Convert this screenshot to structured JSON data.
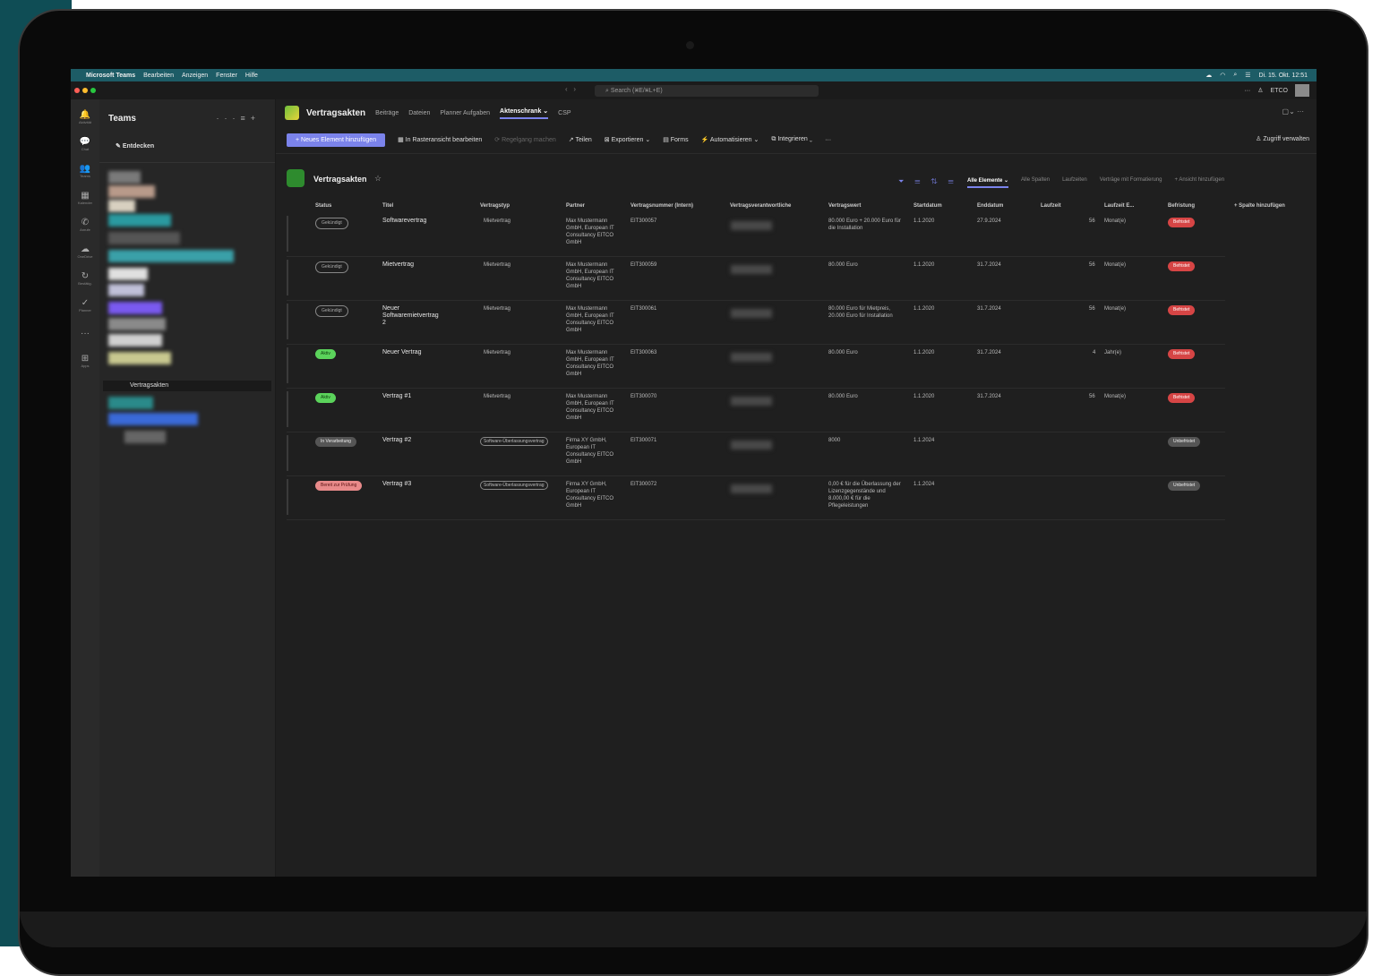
{
  "menubar": {
    "app": "Microsoft Teams",
    "items": [
      "Bearbeiten",
      "Anzeigen",
      "Fenster",
      "Hilfe"
    ],
    "clock": "Di. 15. Okt. 12:51"
  },
  "titlebar": {
    "search_placeholder": "Search (⌘E/⌘L+E)",
    "user": "ETCO"
  },
  "rail": {
    "items": [
      {
        "icon": "bell-icon",
        "glyph": "🔔",
        "label": "Aktivität"
      },
      {
        "icon": "chat-icon",
        "glyph": "💬",
        "label": "Chat"
      },
      {
        "icon": "teams-icon",
        "glyph": "👥",
        "label": "Teams"
      },
      {
        "icon": "calendar-icon",
        "glyph": "▦",
        "label": "Kalender"
      },
      {
        "icon": "phone-icon",
        "glyph": "✆",
        "label": "Anrufe"
      },
      {
        "icon": "cloud-icon",
        "glyph": "☁",
        "label": "OneDrive"
      },
      {
        "icon": "loop-icon",
        "glyph": "↻",
        "label": "Bestätig."
      },
      {
        "icon": "planner-icon",
        "glyph": "✓",
        "label": "Planner"
      },
      {
        "icon": "more-icon",
        "glyph": "···",
        "label": ""
      },
      {
        "icon": "apps-icon",
        "glyph": "⊞",
        "label": "Apps"
      }
    ]
  },
  "teams_pane": {
    "title": "Teams",
    "discover": "Entdecken",
    "selected_channel": "Vertragsakten"
  },
  "tabbar": {
    "title": "Vertragsakten",
    "tabs": [
      "Beiträge",
      "Dateien",
      "Planner Aufgaben",
      "Aktenschrank ⌄",
      "CSP"
    ]
  },
  "cmdbar": {
    "new_item": "+ Neues Element hinzufügen",
    "grid_edit": "In Rasteransicht bearbeiten",
    "rule": "Regelgang machen",
    "share": "Teilen",
    "export": "Exportieren ⌄",
    "forms": "Forms",
    "automate": "Automatisieren ⌄",
    "integrate": "Integrieren ⌄",
    "more": "···",
    "manage_access": "Zugriff verwalten"
  },
  "list": {
    "title": "Vertragsakten",
    "views": [
      "Alle Elemente ⌄",
      "Alle Spalten",
      "Laufzeiten",
      "Verträge mit Formatierung",
      "+ Ansicht hinzufügen"
    ],
    "columns": [
      "Status",
      "Titel",
      "Vertragstyp",
      "Partner",
      "Vertragsnummer (Intern)",
      "Vertragsverantwortliche",
      "Vertragswert",
      "Startdatum",
      "Enddatum",
      "Laufzeit",
      "Laufzeit E...",
      "Befristung",
      "+ Spalte hinzufügen"
    ],
    "rows": [
      {
        "status": "Gekündigt",
        "status_style": "outline",
        "title": "Softwarevertrag",
        "type": "Mietvertrag",
        "partner": "Max Mustermann GmbH, European IT Consultancy EITCO GmbH",
        "number": "EIT300057",
        "value": "80.000 Euro + 20.000 Euro für die Installation",
        "start": "1.1.2020",
        "end": "27.9.2024",
        "duration": "56",
        "unit": "Monat(e)",
        "limit": "Befristet",
        "limit_style": "red"
      },
      {
        "status": "Gekündigt",
        "status_style": "outline",
        "title": "Mietvertrag",
        "type": "Mietvertrag",
        "partner": "Max Mustermann GmbH, European IT Consultancy EITCO GmbH",
        "number": "EIT300059",
        "value": "80.000 Euro",
        "start": "1.1.2020",
        "end": "31.7.2024",
        "duration": "56",
        "unit": "Monat(e)",
        "limit": "Befristet",
        "limit_style": "red"
      },
      {
        "status": "Gekündigt",
        "status_style": "outline",
        "title": "Neuer Softwaremietvertrag 2",
        "type": "Mietvertrag",
        "partner": "Max Mustermann GmbH, European IT Consultancy EITCO GmbH",
        "number": "EIT300061",
        "value": "80.000 Euro für Mietpreis, 20.000 Euro für Installation",
        "start": "1.1.2020",
        "end": "31.7.2024",
        "duration": "56",
        "unit": "Monat(e)",
        "limit": "Befristet",
        "limit_style": "red"
      },
      {
        "status": "Aktiv",
        "status_style": "green",
        "title": "Neuer Vertrag",
        "type": "Mietvertrag",
        "partner": "Max Mustermann GmbH, European IT Consultancy EITCO GmbH",
        "number": "EIT300063",
        "value": "80.000 Euro",
        "start": "1.1.2020",
        "end": "31.7.2024",
        "duration": "4",
        "unit": "Jahr(e)",
        "limit": "Befristet",
        "limit_style": "red"
      },
      {
        "status": "Aktiv",
        "status_style": "green",
        "title": "Vertrag #1",
        "type": "Mietvertrag",
        "partner": "Max Mustermann GmbH, European IT Consultancy EITCO GmbH",
        "number": "EIT300070",
        "value": "80.000 Euro",
        "start": "1.1.2020",
        "end": "31.7.2024",
        "duration": "56",
        "unit": "Monat(e)",
        "limit": "Befristet",
        "limit_style": "red"
      },
      {
        "status": "In Verarbeitung",
        "status_style": "gray",
        "title": "Vertrag #2",
        "type": "Software-Überlassungsvertrag",
        "partner": "Firma XY GmbH, European IT Consultancy EITCO GmbH",
        "number": "EIT300071",
        "value": "8000",
        "start": "1.1.2024",
        "end": "",
        "duration": "",
        "unit": "",
        "limit": "Unbefristet",
        "limit_style": "gray"
      },
      {
        "status": "Bereit zur Prüfung",
        "status_style": "pink",
        "title": "Vertrag #3",
        "type": "Software-Überlassungsvertrag",
        "partner": "Firma XY GmbH, European IT Consultancy EITCO GmbH",
        "number": "EIT300072",
        "value": "0,00 € für die Überlassung der Lizenzgegenstände und 8.000,00 € für die Pflegeleistungen",
        "start": "1.1.2024",
        "end": "",
        "duration": "",
        "unit": "",
        "limit": "Unbefristet",
        "limit_style": "gray"
      }
    ]
  }
}
